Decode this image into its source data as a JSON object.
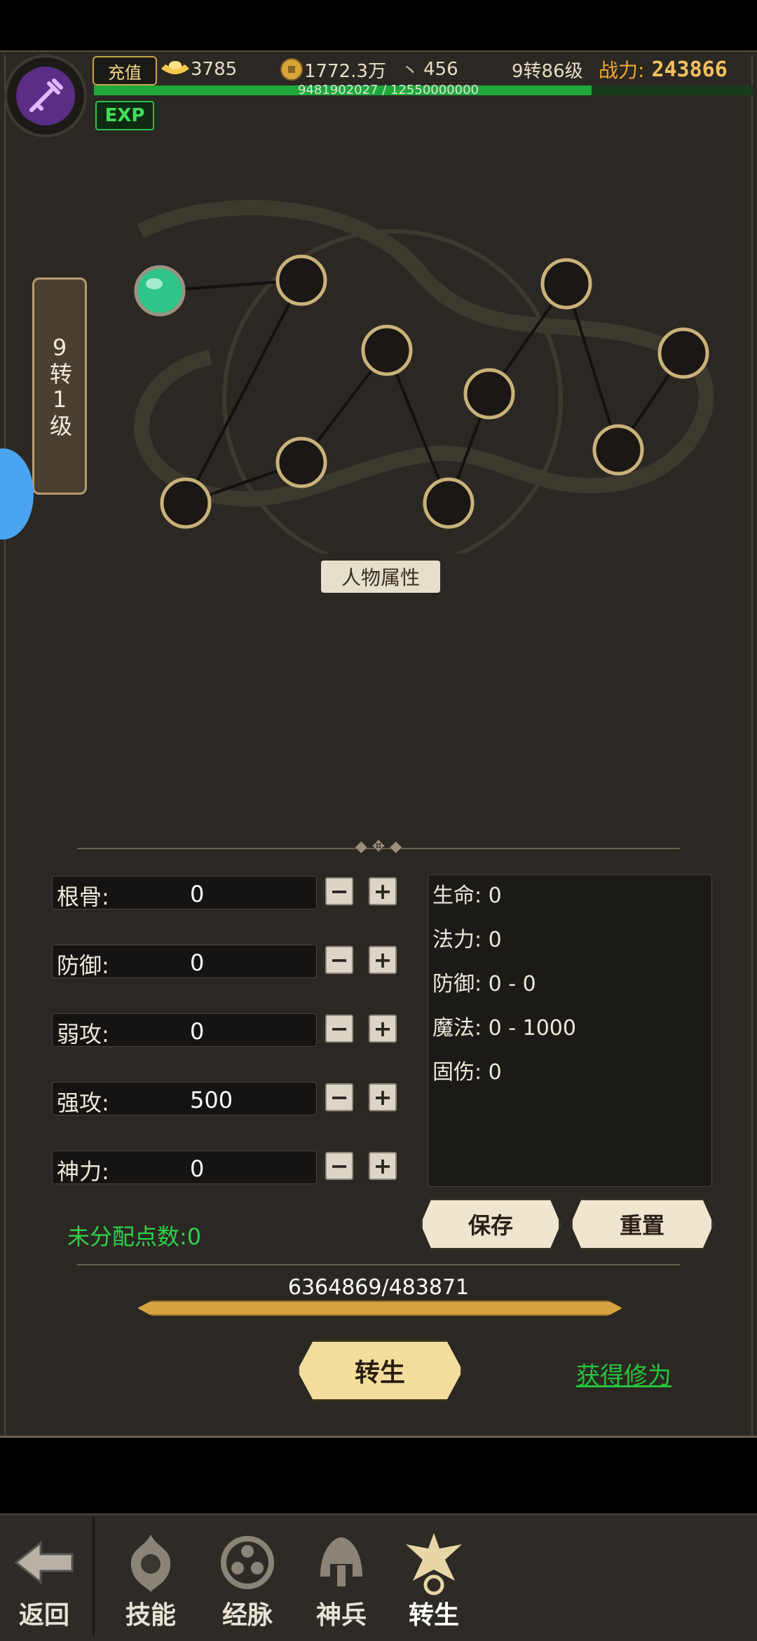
{
  "topbar": {
    "recharge_label": "充值",
    "gold_ingot": "3785",
    "coins": "1772.3万",
    "third_currency": "456",
    "level_text": "9转86级",
    "power_label": "战力:",
    "power_value": "243866",
    "exp_text": "9481902027 / 12550000000",
    "exp_fraction": 0.7555,
    "exp_badge": "EXP"
  },
  "level_badge": {
    "text": "9转1级"
  },
  "tree": {
    "active_node_index": 0
  },
  "section_title": "人物属性",
  "stats": [
    {
      "label": "根骨:",
      "value": "0"
    },
    {
      "label": "防御:",
      "value": "0"
    },
    {
      "label": "弱攻:",
      "value": "0"
    },
    {
      "label": "强攻:",
      "value": "500"
    },
    {
      "label": "神力:",
      "value": "0"
    }
  ],
  "info": [
    "生命: 0",
    "法力: 0",
    "防御: 0 - 0",
    "魔法: 0 - 1000",
    "固伤: 0"
  ],
  "unallocated": "未分配点数:0",
  "buttons": {
    "save": "保存",
    "reset": "重置",
    "rebirth": "转生",
    "gain": "获得修为"
  },
  "progress": {
    "text": "6364869/483871",
    "fraction": 1.0
  },
  "nav": {
    "back": "返回",
    "tabs": [
      "技能",
      "经脉",
      "神兵",
      "转生"
    ],
    "active_tab": 3
  },
  "colors": {
    "accent_green": "#2ed14a",
    "gold": "#f5c060",
    "parchment": "#efe6cf"
  }
}
